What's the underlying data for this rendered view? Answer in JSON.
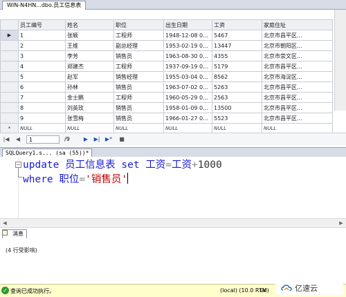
{
  "grid_tab": {
    "title": "WIN-N4HN...dbo.员工信息表"
  },
  "columns": [
    "员工编号",
    "姓名",
    "职位",
    "出生日期",
    "工资",
    "家庭住址"
  ],
  "rows": [
    {
      "id": "1",
      "name": "张颖",
      "position": "工程师",
      "dob": "1948-12-08 00:...",
      "salary": "5467",
      "address": "北京市昌平区..."
    },
    {
      "id": "2",
      "name": "王维",
      "position": "副总经理",
      "dob": "1953-02-19 00:...",
      "salary": "13447",
      "address": "北京市朝阳区..."
    },
    {
      "id": "3",
      "name": "李芳",
      "position": "销售员",
      "dob": "1963-08-30 00:...",
      "salary": "4355",
      "address": "北京市崇文区..."
    },
    {
      "id": "4",
      "name": "郑建杰",
      "position": "工程师",
      "dob": "1937-09-19 00:...",
      "salary": "5179",
      "address": "北京市昌平区..."
    },
    {
      "id": "5",
      "name": "赵军",
      "position": "销售经理",
      "dob": "1955-03-04 00:...",
      "salary": "8562",
      "address": "北京市海淀区..."
    },
    {
      "id": "6",
      "name": "孙林",
      "position": "销售员",
      "dob": "1963-07-02 00:...",
      "salary": "5263",
      "address": "北京市昌平区..."
    },
    {
      "id": "7",
      "name": "金士鹏",
      "position": "工程师",
      "dob": "1960-05-29 00:...",
      "salary": "2563",
      "address": "北京市昌平区..."
    },
    {
      "id": "8",
      "name": "刘英玫",
      "position": "销售员",
      "dob": "1958-01-09 00:...",
      "salary": "13500",
      "address": "北京市昌平区..."
    },
    {
      "id": "9",
      "name": "张雪梅",
      "position": "销售员",
      "dob": "1966-01-27 00:...",
      "salary": "5523",
      "address": "北京市昌平区..."
    }
  ],
  "new_row": {
    "marker": "*",
    "null_label": "NULL"
  },
  "row_marker": "▶",
  "pager": {
    "current": "1",
    "total": "/9"
  },
  "query_tab": {
    "title": "SQLQuery1.s... (sa (55))*"
  },
  "sql": {
    "line1": {
      "kw1": "update",
      "t1": " 员工信息表 ",
      "kw2": "set",
      "t2": " 工资",
      "eq": "=",
      "t3": "工资",
      "plus": "+",
      "t4": "1000"
    },
    "line2": {
      "kw": "where",
      "t1": " 职位",
      "eq": "=",
      "str": "'销售员'"
    }
  },
  "messages_tab": {
    "label": "消息"
  },
  "messages": {
    "text": "(4 行受影响)"
  },
  "status": {
    "message": "查询已成功执行。",
    "server": "(local) (10.0 RTM)",
    "user": "sa"
  },
  "watermark": {
    "text": "亿速云"
  }
}
